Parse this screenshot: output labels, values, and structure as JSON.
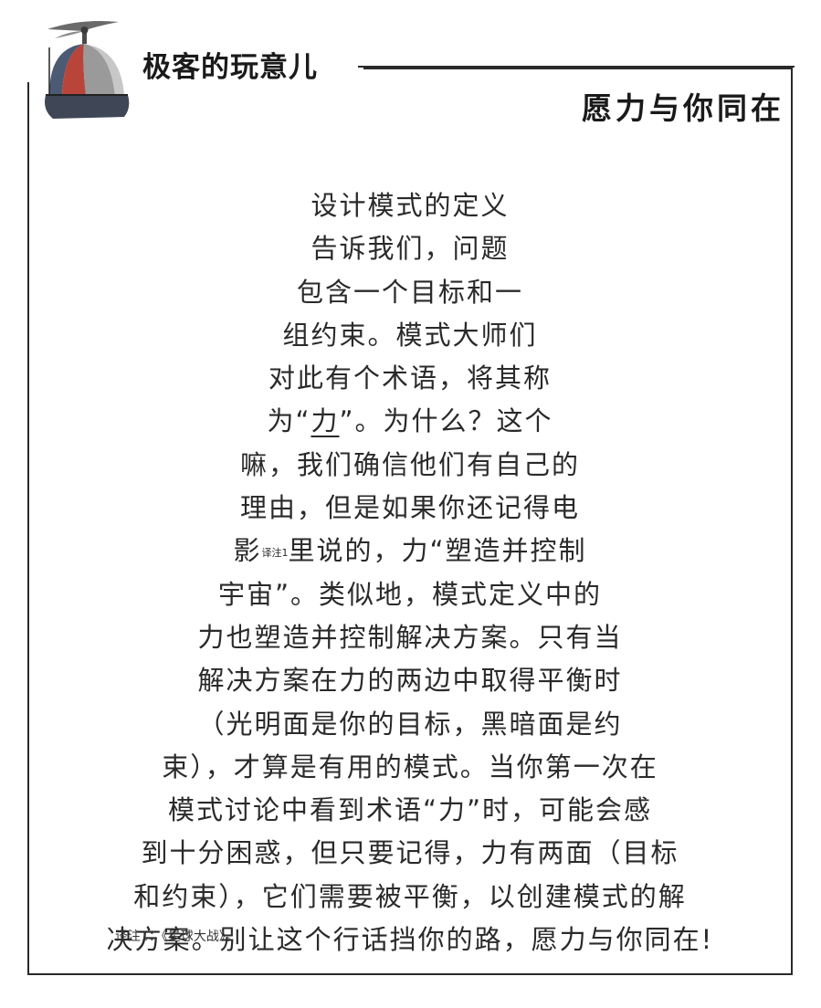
{
  "header": {
    "title": "极客的玩意儿",
    "subtitle": "愿力与你同在"
  },
  "body": {
    "lines": [
      "设计模式的定义",
      "告诉我们，问题",
      "包含一个目标和一",
      "组约束。模式大师们",
      "对此有个术语，将其称",
      {
        "pre": "为“",
        "underlined": "力",
        "post": "”。为什么？这个"
      },
      "嘛，我们确信他们有自己的",
      "理由，但是如果你还记得电",
      {
        "pre": "影",
        "sup": "译注1",
        "post": "里说的，力“塑造并控制"
      },
      "宇宙”。类似地，模式定义中的",
      "力也塑造并控制解决方案。只有当",
      "解决方案在力的两边中取得平衡时",
      "（光明面是你的目标，黑暗面是约",
      "束），才算是有用的模式。当你第一次在",
      "模式讨论中看到术语“力”时，可能会感",
      "到十分困惑，但只要记得，力有两面（目标",
      "和约束），它们需要被平衡，以创建模式的解",
      "决方案。别让这个行话挡你的路，愿力与你同在!"
    ]
  },
  "footnote": {
    "text": "译注1：《星球大战》。"
  },
  "icons": {
    "header_icon": "propeller-beanie-icon"
  },
  "colors": {
    "cap_red": "#b8443a",
    "cap_blue": "#4d5a74",
    "cap_gray": "#9a9a9a",
    "border": "#2a2a2a"
  }
}
